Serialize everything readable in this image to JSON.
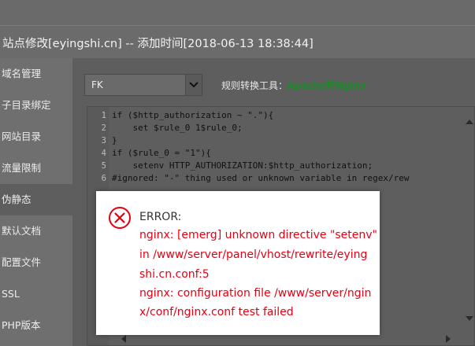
{
  "window": {
    "title": "站点修改[eyingshi.cn] -- 添加时间[2018-06-13 18:38:44]"
  },
  "sidebar": {
    "items": [
      {
        "label": "域名管理"
      },
      {
        "label": "子目录绑定"
      },
      {
        "label": "网站目录"
      },
      {
        "label": "流量限制"
      },
      {
        "label": "伪静态",
        "active": true
      },
      {
        "label": "默认文档"
      },
      {
        "label": "配置文件"
      },
      {
        "label": "SSL"
      },
      {
        "label": "PHP版本"
      }
    ]
  },
  "rewrite": {
    "template_select": "FK",
    "tool_label": "规则转换工具：",
    "tool_link": "Apache转Nginx"
  },
  "editor": {
    "lines": [
      {
        "num": "1",
        "text": "if ($http_authorization ~ \".\"){"
      },
      {
        "num": "2",
        "text": "    set $rule_0 1$rule_0;"
      },
      {
        "num": "3",
        "text": "}"
      },
      {
        "num": "4",
        "text": "if ($rule_0 = \"1\"){"
      },
      {
        "num": "5",
        "text": "    setenv HTTP_AUTHORIZATION:$http_authorization;"
      },
      {
        "num": "6",
        "text": "#ignored: \"-\" thing used or unknown variable in regex/rew"
      }
    ]
  },
  "error_dialog": {
    "title": "ERROR:",
    "lines": [
      "nginx: [emerg] unknown directive \"setenv\"",
      "in /www/server/panel/vhost/rewrite/eying",
      "shi.cn.conf:5",
      "nginx: configuration file /www/server/ngin",
      "x/conf/nginx.conf test failed"
    ]
  },
  "colors": {
    "error_red": "#e60012",
    "link_green": "#1a8a2a"
  },
  "icons": {
    "error": "error-circle-x-icon",
    "select_arrow": "chevron-down-icon"
  }
}
